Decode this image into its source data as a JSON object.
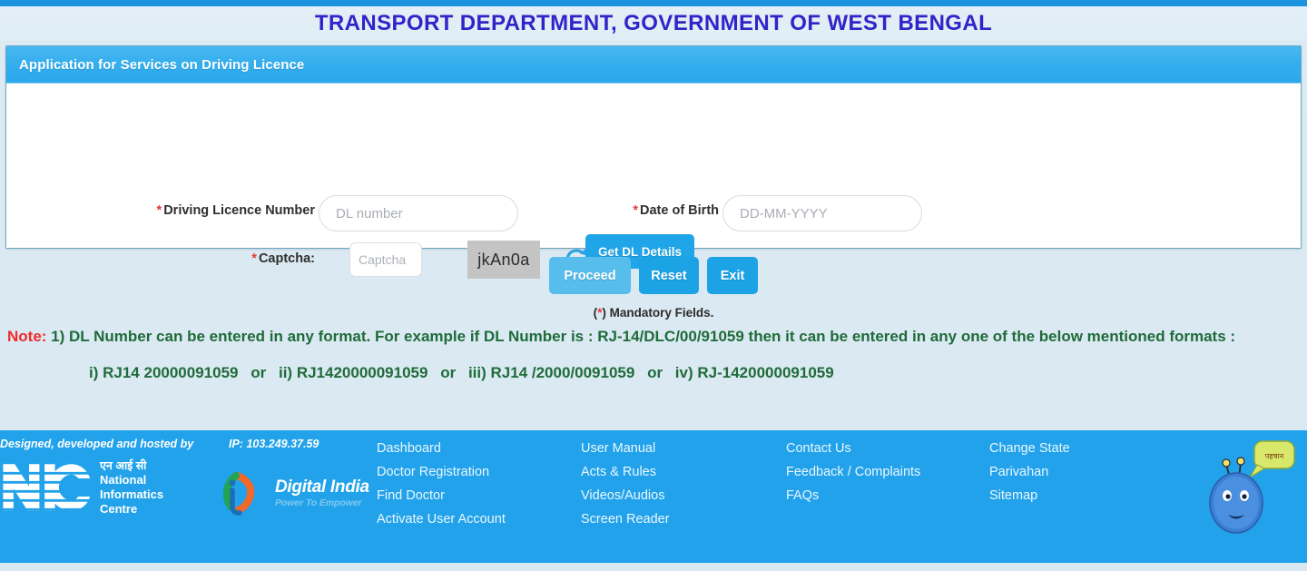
{
  "site": {
    "title": "TRANSPORT DEPARTMENT, GOVERNMENT OF WEST BENGAL",
    "title_color": "#3024c9",
    "top_strip_color": "#1b94dd"
  },
  "panel": {
    "header_title": "Application for Services on Driving Licence",
    "header_color": "#34aeee"
  },
  "form": {
    "dl_label": "Driving Licence Number",
    "dl_placeholder": "DL number",
    "dl_value": "",
    "dob_label": "Date of Birth",
    "dob_placeholder": "DD-MM-YYYY",
    "dob_value": "",
    "captcha_label": "Captcha:",
    "captcha_placeholder": "Captcha",
    "captcha_value": "",
    "captcha_image_text": "jkAn0a",
    "refresh_icon": "refresh-circular-arrow-icon",
    "get_dl_details_label": "Get DL Details",
    "required_marker": "*"
  },
  "actions": {
    "proceed_label": "Proceed",
    "reset_label": "Reset",
    "exit_label": "Exit",
    "proceed_color": "#56bdec",
    "reset_color": "#1ba3e6",
    "exit_color": "#1ba3e6",
    "mandatory_prefix": "(",
    "mandatory_star": "*",
    "mandatory_suffix": ") Mandatory Fields."
  },
  "note": {
    "label": "Note:",
    "label_color": "#ef2b2b",
    "text_color": "#1f6b3a",
    "body": " 1) DL Number can be entered in any format. For example if DL Number is : RJ-14/DLC/00/91059 then it can be entered in any one of the below mentioned formats :",
    "examples": [
      {
        "index": "i)",
        "value": "RJ14 20000091059",
        "or": "or"
      },
      {
        "index": "ii)",
        "value": "RJ1420000091059",
        "or": "or"
      },
      {
        "index": "iii)",
        "value": "RJ14 /2000/0091059",
        "or": "or"
      },
      {
        "index": "iv)",
        "value": "RJ-1420000091059",
        "or": ""
      }
    ]
  },
  "footer": {
    "background_color": "#22a2ea",
    "designed_by": "Designed, developed and hosted by",
    "ip_label": "IP: 103.249.37.59",
    "nic": {
      "mark": "nic-logo-icon",
      "hindi": "एन आई सी",
      "line1": "National",
      "line2": "Informatics",
      "line3": "Centre"
    },
    "digital_india": {
      "icon": "digital-india-icon",
      "main": "Digital India",
      "sub": "Power To Empower"
    },
    "mascot": "blue-mascot-icon",
    "columns": [
      {
        "links": [
          "Dashboard",
          "Doctor Registration",
          "Find Doctor",
          "Activate User Account"
        ]
      },
      {
        "links": [
          "User Manual",
          "Acts & Rules",
          "Videos/Audios",
          "Screen Reader"
        ]
      },
      {
        "links": [
          "Contact Us",
          "Feedback / Complaints",
          "FAQs"
        ]
      },
      {
        "links": [
          "Change State",
          "Parivahan",
          "Sitemap"
        ]
      }
    ]
  }
}
